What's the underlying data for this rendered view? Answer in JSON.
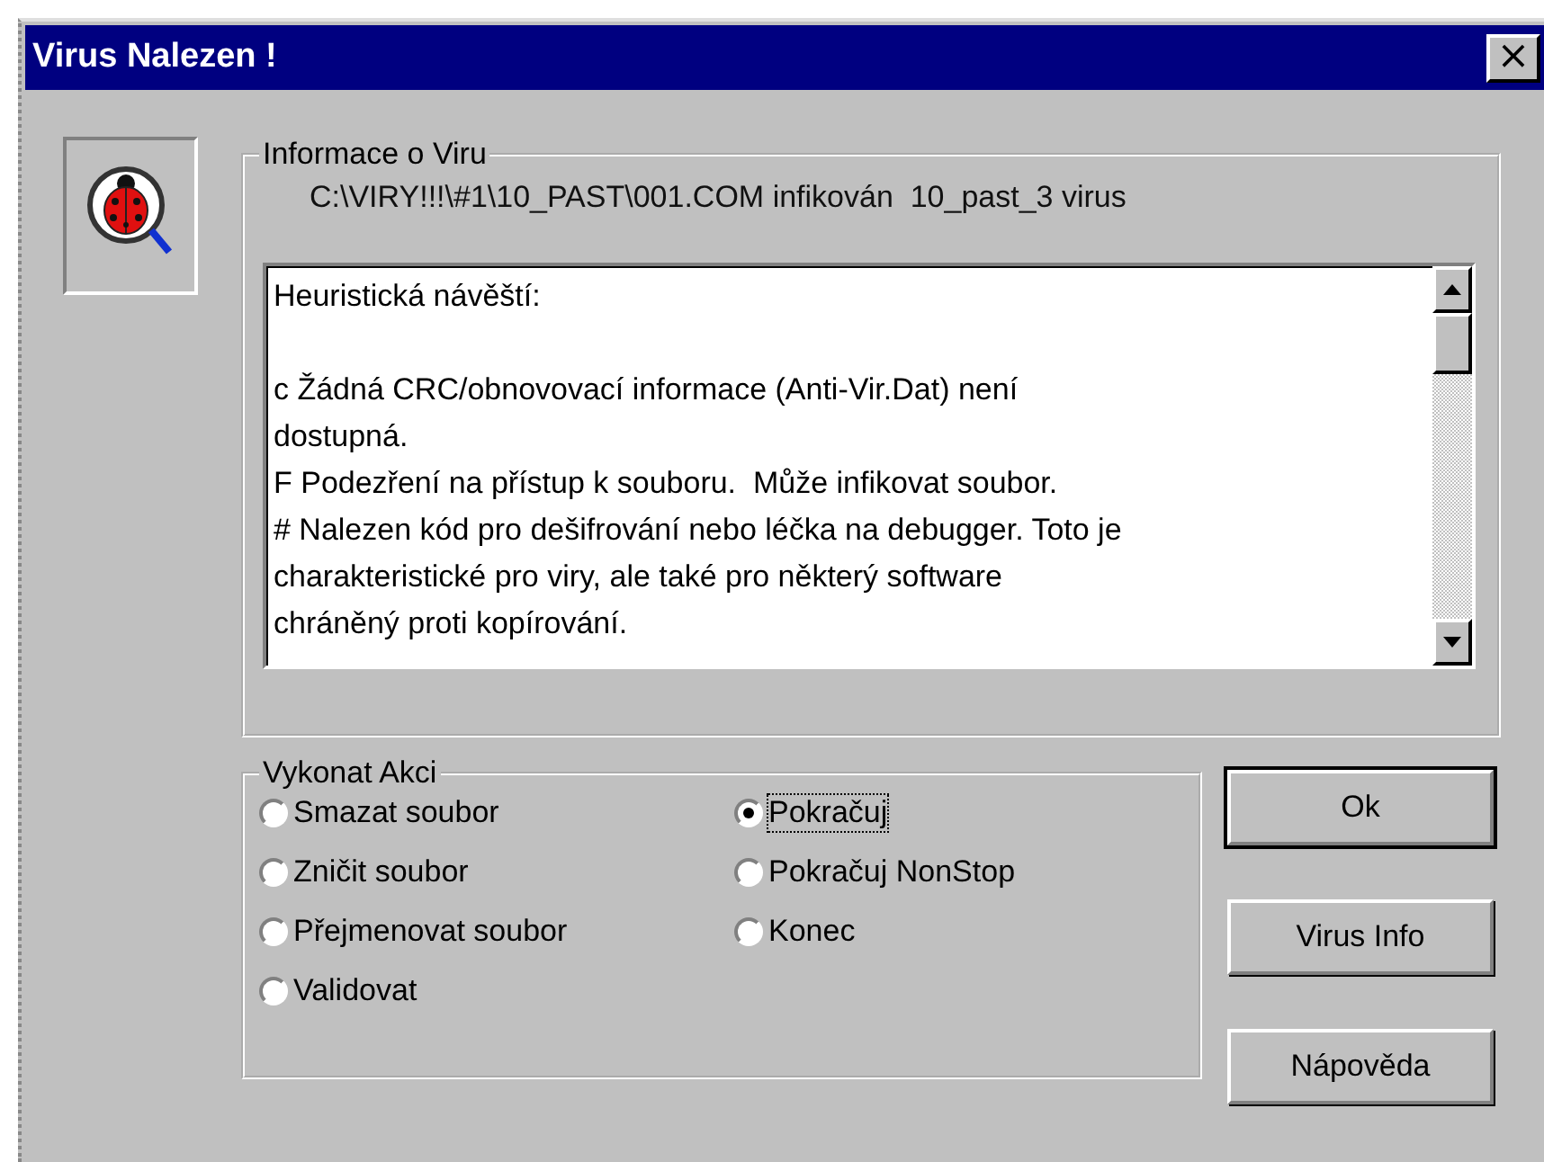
{
  "window": {
    "title": "Virus Nalezen !",
    "close": "×"
  },
  "info_group": {
    "title": "Informace o Viru",
    "path": "C:\\VIRY!!!\\#1\\10_PAST\\001.COM infikován  10_past_3 virus",
    "text_box": {
      "heading": "Heuristická návěští:",
      "lines": [
        "c Žádná CRC/obnovovací informace (Anti-Vir.Dat) není",
        "dostupná.",
        "F Podezření na přístup k souboru.  Může infikovat soubor.",
        "# Nalezen kód pro dešifrování nebo léčka na debugger. Toto je",
        "charakteristické pro viry, ale také pro některý software",
        "chráněný proti kopírování."
      ]
    }
  },
  "action_group": {
    "title": "Vykonat Akci",
    "options": [
      {
        "label": "Smazat soubor",
        "selected": false
      },
      {
        "label": "Zničit soubor",
        "selected": false
      },
      {
        "label": "Přejmenovat soubor",
        "selected": false
      },
      {
        "label": "Validovat",
        "selected": false
      },
      {
        "label": "Pokračuj",
        "selected": true
      },
      {
        "label": "Pokračuj NonStop",
        "selected": false
      },
      {
        "label": "Konec",
        "selected": false
      }
    ]
  },
  "buttons": [
    {
      "label": "Ok",
      "default": true
    },
    {
      "label": "Virus Info",
      "default": false
    },
    {
      "label": "Nápověda",
      "default": false
    }
  ]
}
